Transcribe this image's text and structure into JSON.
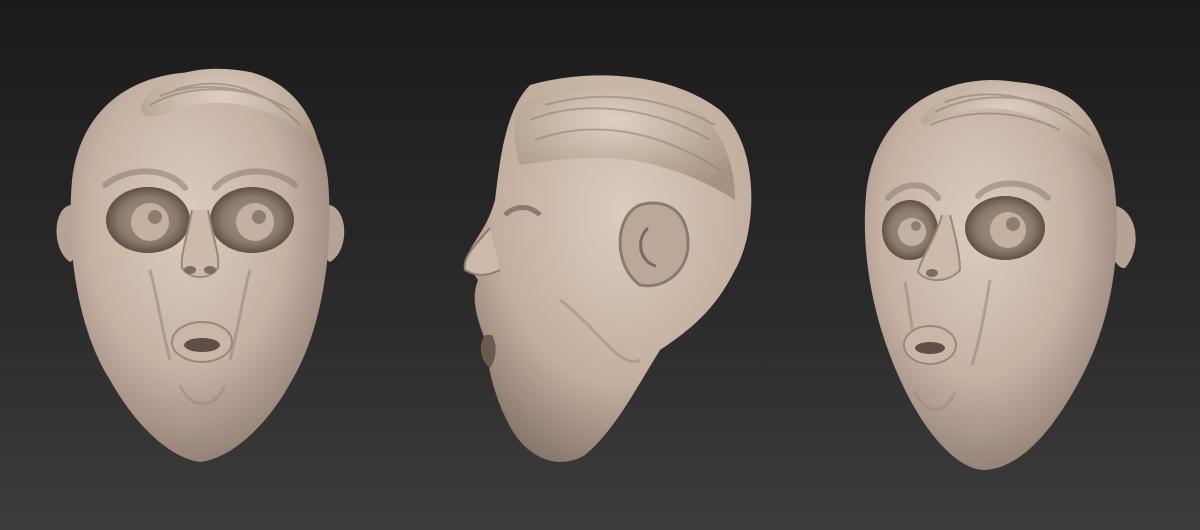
{
  "scene": {
    "background_top": "#1c1c1c",
    "background_bottom": "#3b3b3b",
    "sculpt_base_color": "#c9b6a6",
    "sculpt_light_color": "#ddccbe",
    "sculpt_shadow_color": "#6e5d52",
    "views": [
      {
        "name": "front-view"
      },
      {
        "name": "side-view"
      },
      {
        "name": "three-quarter-view"
      }
    ]
  }
}
